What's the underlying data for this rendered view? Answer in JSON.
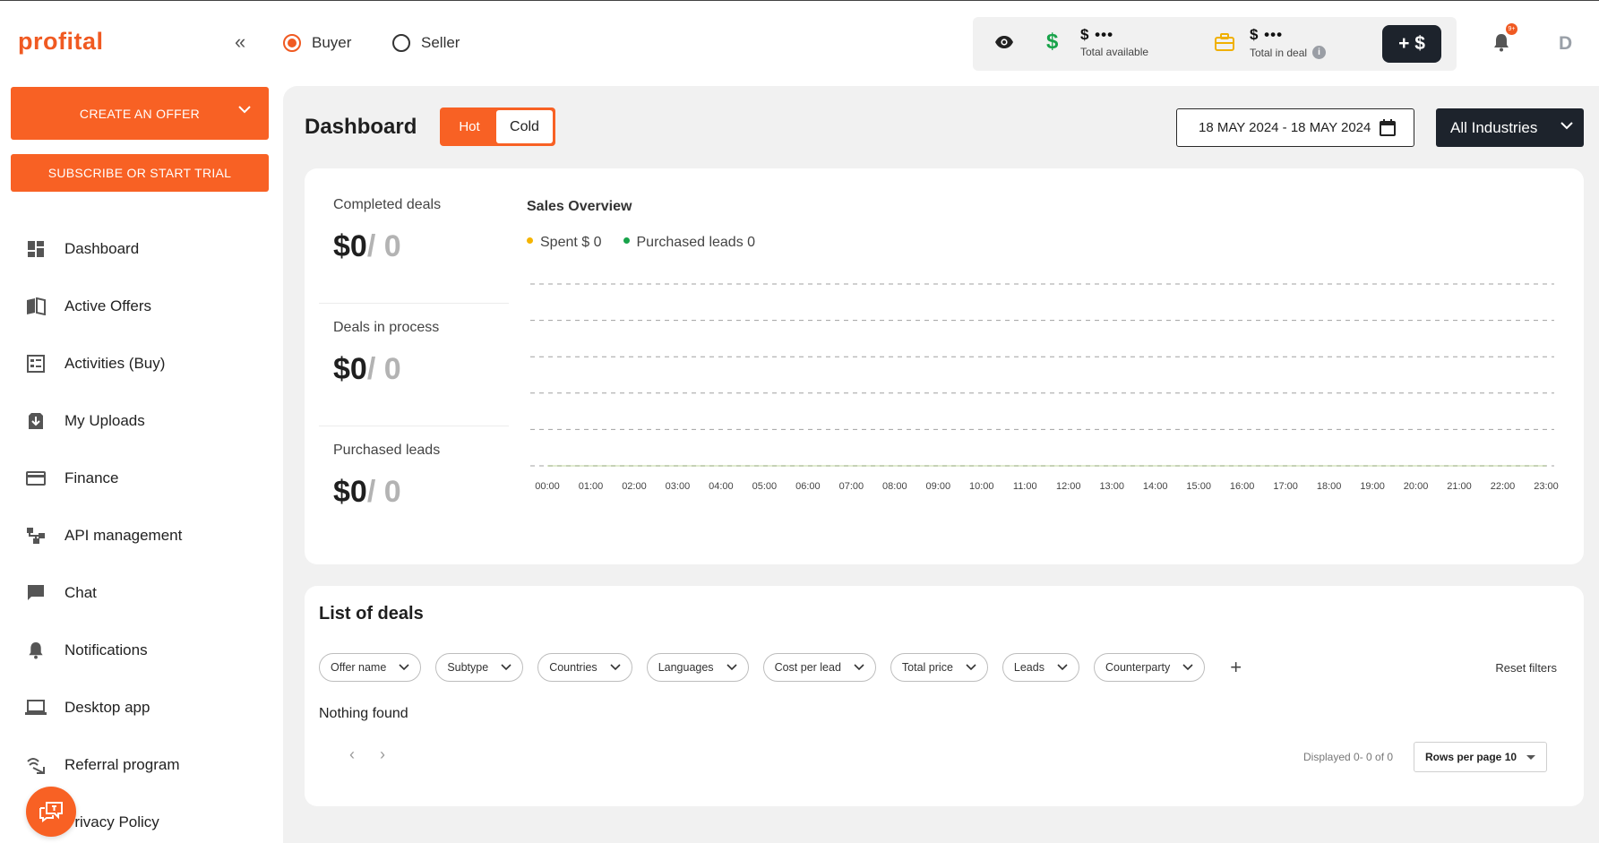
{
  "brand": {
    "logo": "profital",
    "accent": "#f86124",
    "dark": "#1d232c"
  },
  "header": {
    "roles": [
      {
        "label": "Buyer",
        "selected": true
      },
      {
        "label": "Seller",
        "selected": false
      }
    ],
    "balance": {
      "available_value": "$ •••",
      "available_label": "Total available",
      "deal_value": "$ •••",
      "deal_label": "Total in deal",
      "add_button": "+ $"
    },
    "notifications_badge": "9+",
    "avatar_letter": "D"
  },
  "sidebar": {
    "create_offer": "CREATE AN OFFER",
    "subscribe": "SUBSCRIBE OR START TRIAL",
    "items": [
      {
        "label": "Dashboard",
        "icon": "dashboard-icon"
      },
      {
        "label": "Active Offers",
        "icon": "book-icon"
      },
      {
        "label": "Activities (Buy)",
        "icon": "list-icon"
      },
      {
        "label": "My Uploads",
        "icon": "upload-icon"
      },
      {
        "label": "Finance",
        "icon": "card-icon"
      },
      {
        "label": "API management",
        "icon": "api-icon"
      },
      {
        "label": "Chat",
        "icon": "chat-icon"
      },
      {
        "label": "Notifications",
        "icon": "bell-icon"
      },
      {
        "label": "Desktop app",
        "icon": "laptop-icon"
      },
      {
        "label": "Referral program",
        "icon": "referral-icon"
      },
      {
        "label": "Privacy Policy",
        "icon": "policy-icon"
      }
    ]
  },
  "dashboard": {
    "title": "Dashboard",
    "mode_hot": "Hot",
    "mode_cold": "Cold",
    "date_range": "18 MAY 2024 - 18 MAY 2024",
    "industry": "All Industries",
    "stats": [
      {
        "label": "Completed deals",
        "amount": "$0",
        "count": "/ 0"
      },
      {
        "label": "Deals in process",
        "amount": "$0",
        "count": "/ 0"
      },
      {
        "label": "Purchased leads",
        "amount": "$0",
        "count": "/ 0"
      }
    ],
    "sales_overview_title": "Sales Overview",
    "legend": [
      {
        "label": "Spent $ 0",
        "color": "#f5b400"
      },
      {
        "label": "Purchased leads 0",
        "color": "#18a34a"
      }
    ]
  },
  "chart_data": {
    "type": "line",
    "title": "Sales Overview",
    "x": [
      "00:00",
      "01:00",
      "02:00",
      "03:00",
      "04:00",
      "05:00",
      "06:00",
      "07:00",
      "08:00",
      "09:00",
      "10:00",
      "11:00",
      "12:00",
      "13:00",
      "14:00",
      "15:00",
      "16:00",
      "17:00",
      "18:00",
      "19:00",
      "20:00",
      "21:00",
      "22:00",
      "23:00"
    ],
    "y_ticks": [
      "0.0",
      "0.4",
      "0.8",
      "1.2",
      "1.6",
      "2.0"
    ],
    "ylim": [
      0,
      2.0
    ],
    "grid": true,
    "series": [
      {
        "name": "Spent $ 0",
        "values": [
          0,
          0,
          0,
          0,
          0,
          0,
          0,
          0,
          0,
          0,
          0,
          0,
          0,
          0,
          0,
          0,
          0,
          0,
          0,
          0,
          0,
          0,
          0,
          0
        ]
      },
      {
        "name": "Purchased leads 0",
        "values": [
          0,
          0,
          0,
          0,
          0,
          0,
          0,
          0,
          0,
          0,
          0,
          0,
          0,
          0,
          0,
          0,
          0,
          0,
          0,
          0,
          0,
          0,
          0,
          0
        ]
      }
    ]
  },
  "deals": {
    "title": "List of deals",
    "filters": [
      "Offer name",
      "Subtype",
      "Countries",
      "Languages",
      "Cost per lead",
      "Total price",
      "Leads",
      "Counterparty"
    ],
    "reset": "Reset filters",
    "empty": "Nothing found",
    "displayed": "Displayed 0- 0 of 0",
    "rows_per_page": "Rows per page 10"
  }
}
